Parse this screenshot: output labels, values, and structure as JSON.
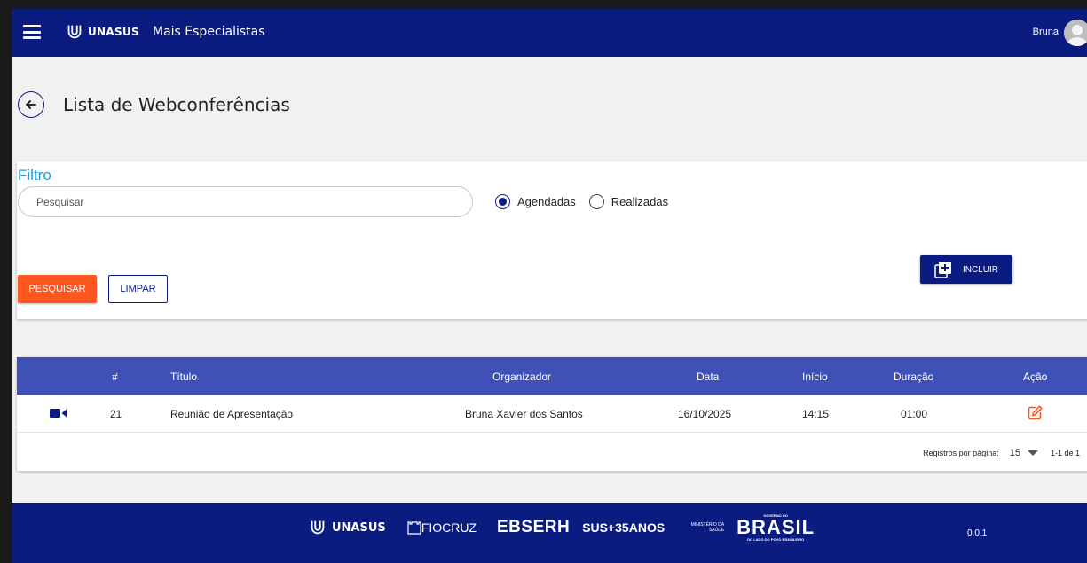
{
  "header": {
    "brand": "UNASUS",
    "app_name": "Mais Especialistas",
    "user_name": "Bruna"
  },
  "page": {
    "title": "Lista de Webconferências"
  },
  "filter": {
    "title": "Filtro",
    "search_placeholder": "Pesquisar",
    "radio_options": [
      {
        "label": "Agendadas",
        "checked": true
      },
      {
        "label": "Realizadas",
        "checked": false
      }
    ],
    "search_button": "PESQUISAR",
    "clear_button": "LIMPAR",
    "include_button": "INCLUIR"
  },
  "table": {
    "columns": [
      "#",
      "Título",
      "Organizador",
      "Data",
      "Início",
      "Duração",
      "Ação"
    ],
    "rows": [
      {
        "icon": "video-icon",
        "id": "21",
        "title": "Reunião de Apresentação",
        "organizer": "Bruna Xavier dos Santos",
        "date": "16/10/2025",
        "start": "14:15",
        "duration": "01:00",
        "action_icon": "edit-icon"
      }
    ],
    "pagination": {
      "label": "Registros por página:",
      "page_size": "15",
      "range": "1-1 de 1"
    }
  },
  "footer": {
    "logos": {
      "unasus": "UNASUS",
      "fiocruz": "FIOCRUZ",
      "ebserh": "EBSERH",
      "sus": "SUS+35ANOS",
      "ministerio": "MINISTÉRIO DA SAÚDE",
      "governo": "GOVERNO DO",
      "brasil": "BRASIL",
      "brasil_tag": "DO LADO DO POVO BRASILEIRO"
    },
    "version": "0.0.1"
  },
  "colors": {
    "primary": "#0b1c80",
    "table_header": "#3f51b5",
    "accent": "#ff5722",
    "filter_title": "#1e9ad6"
  }
}
